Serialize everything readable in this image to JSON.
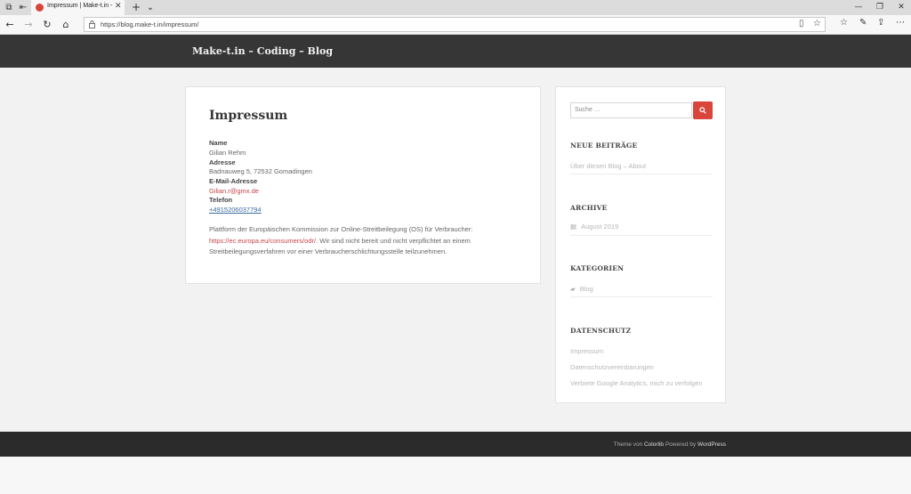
{
  "browser": {
    "tab_title": "Impressum | Make-t.in -",
    "url": "https://blog.make-t.in/impressum/",
    "icons": {
      "tab_actions": "tab-actions-icon",
      "set_aside": "set-aside-tabs-icon",
      "close": "close-icon",
      "new_tab": "plus-icon",
      "tab_list": "chevron-down-icon",
      "back": "arrow-left-icon",
      "forward": "arrow-right-icon",
      "refresh": "refresh-icon",
      "home": "home-icon",
      "lock": "lock-icon",
      "reading_view": "reading-view-icon",
      "favorite": "star-icon",
      "favorites_hub": "favorites-icon",
      "notes": "pen-icon",
      "share": "share-icon",
      "more": "more-icon"
    },
    "glyphs": {
      "tab_actions": "⧉",
      "set_aside": "⇤",
      "close": "✕",
      "new_tab": "+",
      "tab_list": "⌄",
      "minimize": "—",
      "maximize": "❐",
      "window_close": "✕",
      "back": "←",
      "forward": "→",
      "refresh": "↻",
      "home": "⌂",
      "reading_view": "▯",
      "favorite": "☆",
      "favorites_hub": "☆",
      "notes": "✎",
      "share": "⇪",
      "more": "⋯"
    }
  },
  "site": {
    "title": "Make-t.in – Coding – Blog",
    "accent_color": "#d9443b",
    "header_color": "#363636"
  },
  "page": {
    "title": "Impressum",
    "fields": {
      "name_label": "Name",
      "name_value": "Gilian Rehm",
      "address_label": "Adresse",
      "address_value": "Badnauweg 5, 72532 Gomadingen",
      "email_label": "E-Mail-Adresse",
      "email_value": "Gilian.r@gmx.de",
      "phone_label": "Telefon",
      "phone_value": "+4915206037794"
    },
    "paragraph": {
      "line1": "Plattform der Europäischen Kommission zur Online-Streitbeilegung (OS) für Verbraucher:",
      "link": "https://ec.europa.eu/consumers/odr/",
      "line2_rest": ". Wir sind nicht bereit und nicht verpflichtet an einem",
      "line3": "Streitbeilegungsverfahren vor einer Verbraucherschlichtungsstelle teilzunehmen."
    }
  },
  "sidebar": {
    "search_placeholder": "Suche …",
    "search_icon": "search-icon",
    "recent": {
      "title": "NEUE BEITRÄGE",
      "items": [
        "Über diesen Blog – About"
      ]
    },
    "archive": {
      "title": "ARCHIVE",
      "icon": "calendar-icon",
      "icon_glyph": "▦",
      "items": [
        "August 2019"
      ]
    },
    "categories": {
      "title": "KATEGORIEN",
      "icon": "folder-icon",
      "icon_glyph": "▰",
      "items": [
        "Blog"
      ]
    },
    "privacy": {
      "title": "DATENSCHUTZ",
      "items": [
        "Impressum",
        "Datenschutzvereinbarungen",
        "Verbiete Google Analytics, mich zu verfolgen"
      ]
    }
  },
  "footer": {
    "prefix": "Theme von ",
    "theme_link": "Colorlib",
    "middle": " Powered by ",
    "wp_link": "WordPress"
  }
}
